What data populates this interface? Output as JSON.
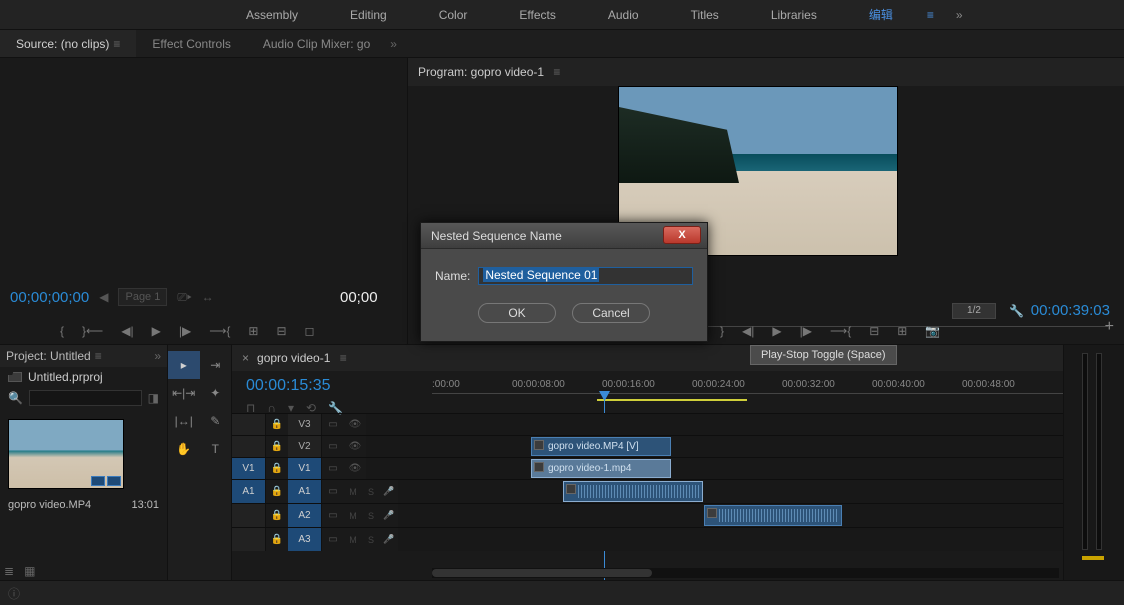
{
  "topbar": {
    "tabs": [
      "Assembly",
      "Editing",
      "Color",
      "Effects",
      "Audio",
      "Titles",
      "Libraries"
    ],
    "edit_label": "编辑"
  },
  "source": {
    "tabs": {
      "source": "Source: (no clips)",
      "effect": "Effect Controls",
      "mixer": "Audio Clip Mixer: go"
    },
    "tc_left": "00;00;00;00",
    "page": "Page 1",
    "tc_right": "00;00"
  },
  "program": {
    "title": "Program: gopro video-1",
    "resolution": "1/2",
    "tc_right": "00:00:39:03"
  },
  "tooltip": "Play-Stop Toggle (Space)",
  "project": {
    "title": "Project: Untitled",
    "file": "Untitled.prproj",
    "item_name": "gopro video.MP4",
    "item_dur": "13:01"
  },
  "timeline": {
    "seq_name": "gopro video-1",
    "tc": "00:00:15:35",
    "ruler": [
      ":00:00",
      "00:00:08:00",
      "00:00:16:00",
      "00:00:24:00",
      "00:00:32:00",
      "00:00:40:00",
      "00:00:48:00"
    ],
    "tracks": {
      "v3": "V3",
      "v2": "V2",
      "v1": "V1",
      "a1": "A1",
      "a2": "A2",
      "a3": "A3"
    },
    "clips": {
      "v2": "gopro video.MP4 [V]",
      "v1": "gopro video-1.mp4"
    }
  },
  "modal": {
    "title": "Nested Sequence Name",
    "label": "Name:",
    "value": "Nested Sequence 01",
    "ok": "OK",
    "cancel": "Cancel"
  }
}
